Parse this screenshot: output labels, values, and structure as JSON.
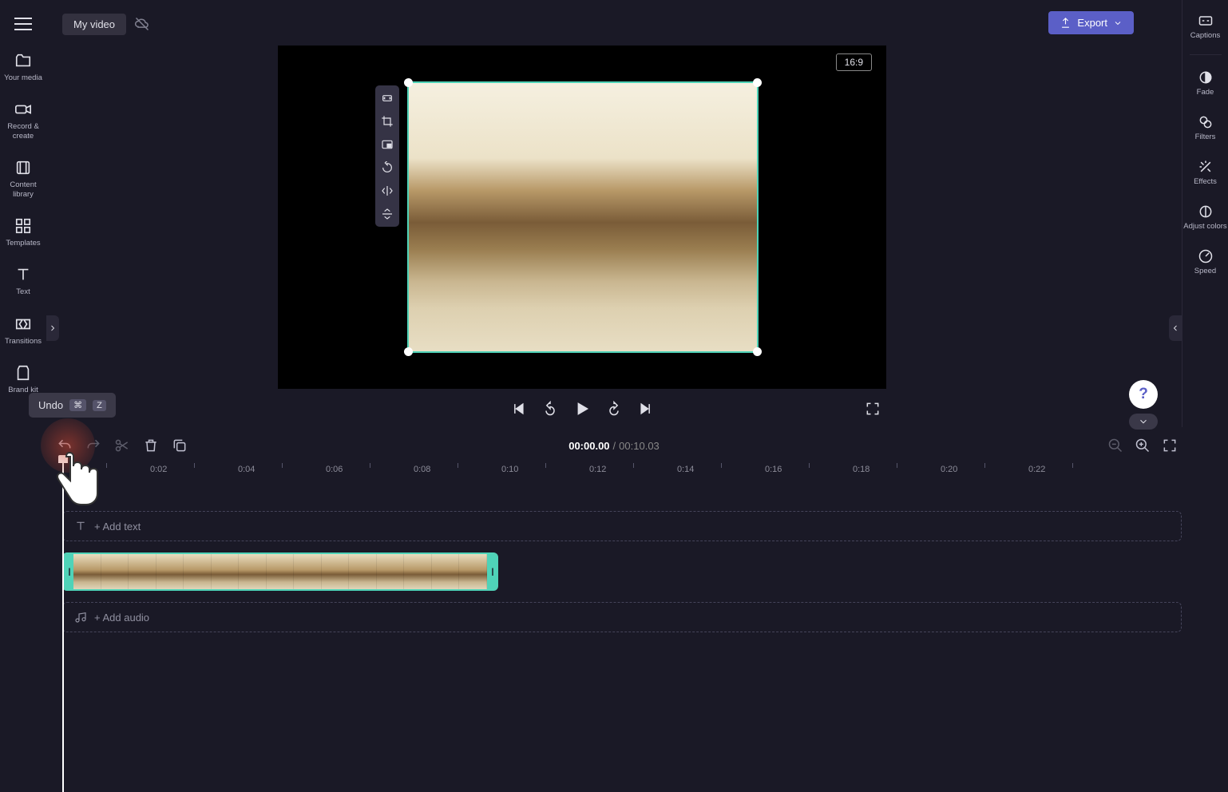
{
  "header": {
    "project_title": "My video",
    "export_label": "Export"
  },
  "left_sidebar": {
    "items": [
      {
        "label": "Your media"
      },
      {
        "label": "Record & create"
      },
      {
        "label": "Content library"
      },
      {
        "label": "Templates"
      },
      {
        "label": "Text"
      },
      {
        "label": "Transitions"
      },
      {
        "label": "Brand kit"
      }
    ]
  },
  "right_sidebar": {
    "items": [
      {
        "label": "Captions"
      },
      {
        "label": "Fade"
      },
      {
        "label": "Filters"
      },
      {
        "label": "Effects"
      },
      {
        "label": "Adjust colors"
      },
      {
        "label": "Speed"
      }
    ]
  },
  "preview": {
    "aspect_ratio": "16:9"
  },
  "timecode": {
    "current": "00:00.00",
    "total": "00:10.03"
  },
  "ruler": {
    "ticks": [
      "0:02",
      "0:04",
      "0:06",
      "0:08",
      "0:10",
      "0:12",
      "0:14",
      "0:16",
      "0:18",
      "0:20",
      "0:22"
    ]
  },
  "tracks": {
    "text_placeholder": "+ Add text",
    "audio_placeholder": "+ Add audio"
  },
  "tooltip": {
    "label": "Undo",
    "key1": "⌘",
    "key2": "Z"
  },
  "help": {
    "label": "?"
  }
}
